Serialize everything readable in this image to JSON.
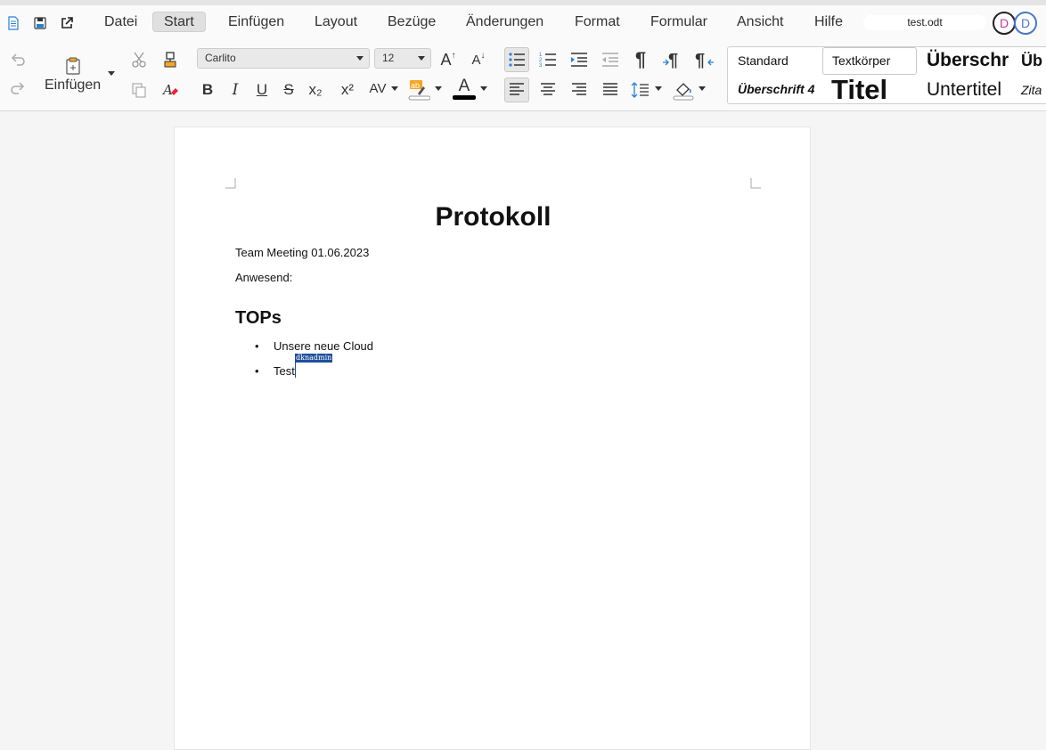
{
  "menubar": {
    "icons": [
      "document-icon",
      "save-icon",
      "open-external-icon"
    ],
    "items": [
      "Datei",
      "Start",
      "Einfügen",
      "Layout",
      "Bezüge",
      "Änderungen",
      "Format",
      "Formular",
      "Ansicht",
      "Hilfe"
    ],
    "active": "Start",
    "doc_name": "test.odt",
    "avatars": [
      {
        "initial": "D",
        "color": "#c0389a"
      },
      {
        "initial": "D",
        "color": "#4a78c8"
      }
    ]
  },
  "toolbar": {
    "paste_label": "Einfügen",
    "font_name": "Carlito",
    "font_size": "12",
    "bold": "B",
    "italic": "I",
    "underline": "U",
    "strike": "S",
    "subscript": "x₂",
    "superscript": "x²",
    "spacing": "AV",
    "font_color_glyph": "A",
    "grow_font": "A",
    "shrink_font": "A",
    "pilcrow": "¶",
    "highlight_color": "#f5a623",
    "font_color": "#000000"
  },
  "styles": {
    "standard": "Standard",
    "textkoerper": "Textkörper",
    "ueberschrift1": "Überschr",
    "ueberschrift2": "Üb",
    "ueberschrift4": "Überschrift 4",
    "titel": "Titel",
    "untertitel": "Untertitel",
    "zitat": "Zita"
  },
  "document": {
    "title": "Protokoll",
    "line1": "Team Meeting 01.06.2023",
    "line2": "Anwesend:",
    "heading": "TOPs",
    "bullets": [
      "Unsere neue Cloud",
      "Test"
    ],
    "bullet_glyph": "•",
    "cursor_user": "dknadmin"
  }
}
